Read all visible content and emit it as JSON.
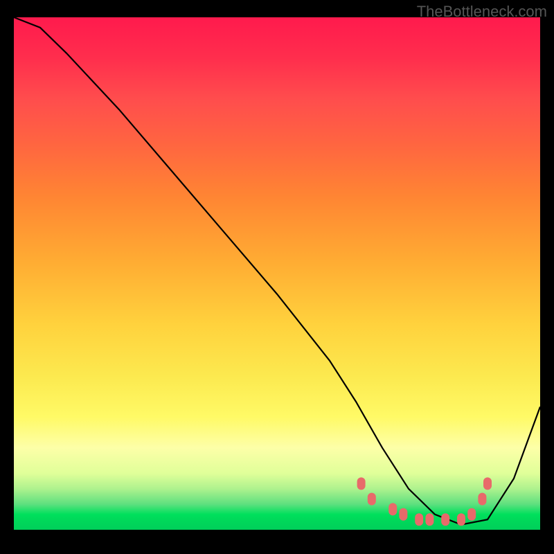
{
  "watermark": "TheBottleneck.com",
  "chart_data": {
    "type": "line",
    "title": "",
    "xlabel": "",
    "ylabel": "",
    "xlim": [
      0,
      100
    ],
    "ylim": [
      0,
      100
    ],
    "series": [
      {
        "name": "bottleneck-curve",
        "x": [
          0,
          5,
          10,
          20,
          30,
          40,
          50,
          60,
          65,
          70,
          75,
          80,
          85,
          90,
          95,
          100
        ],
        "values": [
          100,
          98,
          93,
          82,
          70,
          58,
          46,
          33,
          25,
          16,
          8,
          3,
          1,
          2,
          10,
          24
        ]
      }
    ],
    "highlight_points": {
      "name": "optimal-range",
      "x": [
        66,
        68,
        72,
        74,
        77,
        79,
        82,
        85,
        87,
        89,
        90
      ],
      "values": [
        9,
        6,
        4,
        3,
        2,
        2,
        2,
        2,
        3,
        6,
        9
      ]
    },
    "background_gradient": {
      "top_color": "#ff1a4d",
      "mid_color": "#fce94f",
      "bottom_color": "#00cf5a"
    }
  }
}
